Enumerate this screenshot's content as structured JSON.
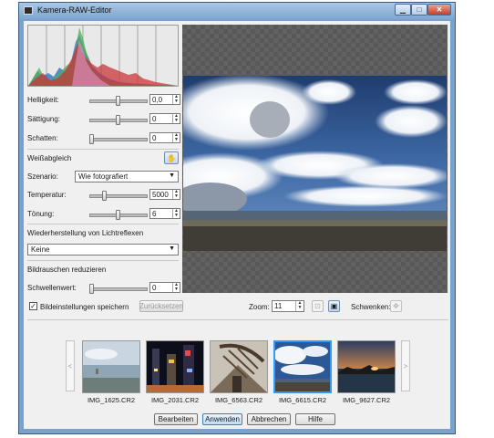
{
  "window": {
    "title": "Kamera-RAW-Editor"
  },
  "adjust": {
    "brightness": {
      "label": "Helligkeit:",
      "value": "0,0",
      "level": 0.5
    },
    "saturation": {
      "label": "Sättigung:",
      "value": "0",
      "level": 0.5
    },
    "shadows": {
      "label": "Schatten:",
      "value": "0",
      "level": 0.0
    }
  },
  "white_balance": {
    "title": "Weißabgleich",
    "scenario_label": "Szenario:",
    "scenario_value": "Wie fotografiert",
    "temperature": {
      "label": "Temperatur:",
      "value": "5000",
      "level": 0.25
    },
    "tint": {
      "label": "Tönung:",
      "value": "6",
      "level": 0.5
    }
  },
  "highlights": {
    "title": "Wiederherstellung von Lichtreflexen",
    "value": "Keine"
  },
  "noise": {
    "title": "Bildrauschen reduzieren",
    "threshold_label": "Schwellenwert:",
    "value": "0",
    "level": 0.0
  },
  "save_settings": {
    "label": "Bildeinstellungen speichern",
    "checked": true
  },
  "reset_label": "Zurücksetzen",
  "zoom": {
    "label": "Zoom:",
    "value": "11"
  },
  "pan_label": "Schwenken:",
  "thumbnails": [
    {
      "name": "IMG_1625.CR2",
      "icon": "lake-photo"
    },
    {
      "name": "IMG_2031.CR2",
      "icon": "city-night-photo"
    },
    {
      "name": "IMG_6563.CR2",
      "icon": "bridge-photo"
    },
    {
      "name": "IMG_6615.CR2",
      "icon": "sky-clouds-photo"
    },
    {
      "name": "IMG_9627.CR2",
      "icon": "sunset-photo"
    }
  ],
  "buttons": {
    "edit": "Bearbeiten",
    "apply": "Anwenden",
    "cancel": "Abbrechen",
    "help": "Hilfe"
  },
  "nav": {
    "prev": "<",
    "next": ">"
  },
  "colors": {
    "titlebar": "#7ea6cf",
    "preview_bg": "#585858",
    "selected_thumb": "#3399ff"
  }
}
